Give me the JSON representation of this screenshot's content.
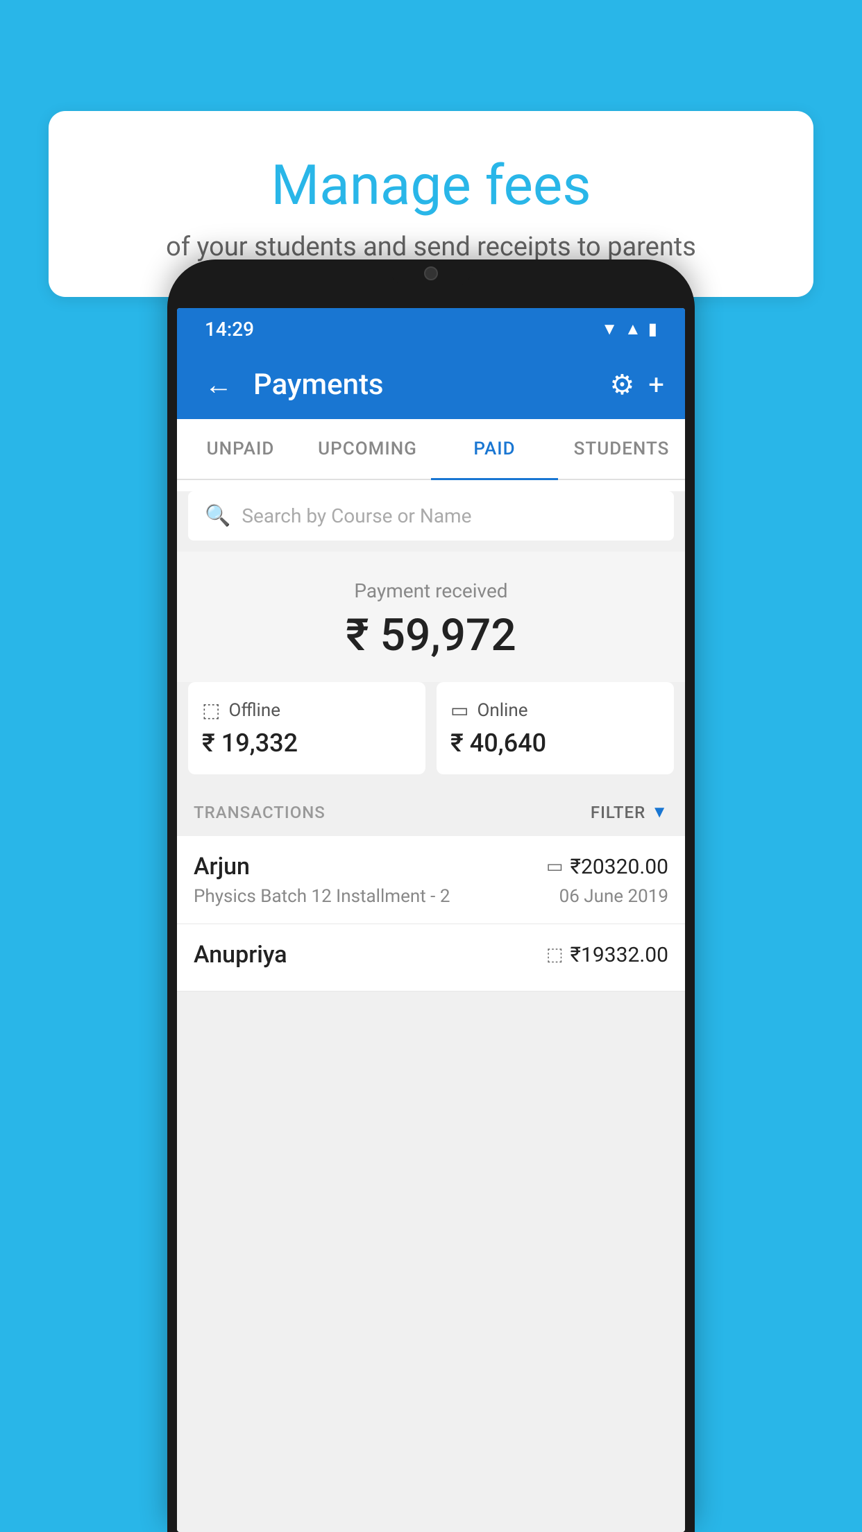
{
  "background_color": "#29b6e8",
  "speech_bubble": {
    "title": "Manage fees",
    "subtitle": "of your students and send receipts to parents"
  },
  "status_bar": {
    "time": "14:29",
    "wifi_icon": "wifi",
    "signal_icon": "signal",
    "battery_icon": "battery"
  },
  "top_bar": {
    "back_icon": "←",
    "title": "Payments",
    "settings_icon": "⚙",
    "add_icon": "+"
  },
  "tabs": [
    {
      "label": "UNPAID",
      "active": false
    },
    {
      "label": "UPCOMING",
      "active": false
    },
    {
      "label": "PAID",
      "active": true
    },
    {
      "label": "STUDENTS",
      "active": false
    }
  ],
  "search": {
    "placeholder": "Search by Course or Name"
  },
  "payment_received": {
    "label": "Payment received",
    "amount": "₹ 59,972"
  },
  "payment_cards": [
    {
      "icon": "offline",
      "label": "Offline",
      "amount": "₹ 19,332"
    },
    {
      "icon": "online",
      "label": "Online",
      "amount": "₹ 40,640"
    }
  ],
  "transactions_section": {
    "label": "TRANSACTIONS",
    "filter_label": "FILTER"
  },
  "transactions": [
    {
      "name": "Arjun",
      "course": "Physics Batch 12 Installment - 2",
      "amount": "₹20320.00",
      "date": "06 June 2019",
      "payment_type": "card"
    },
    {
      "name": "Anupriya",
      "course": "",
      "amount": "₹19332.00",
      "date": "",
      "payment_type": "offline"
    }
  ]
}
